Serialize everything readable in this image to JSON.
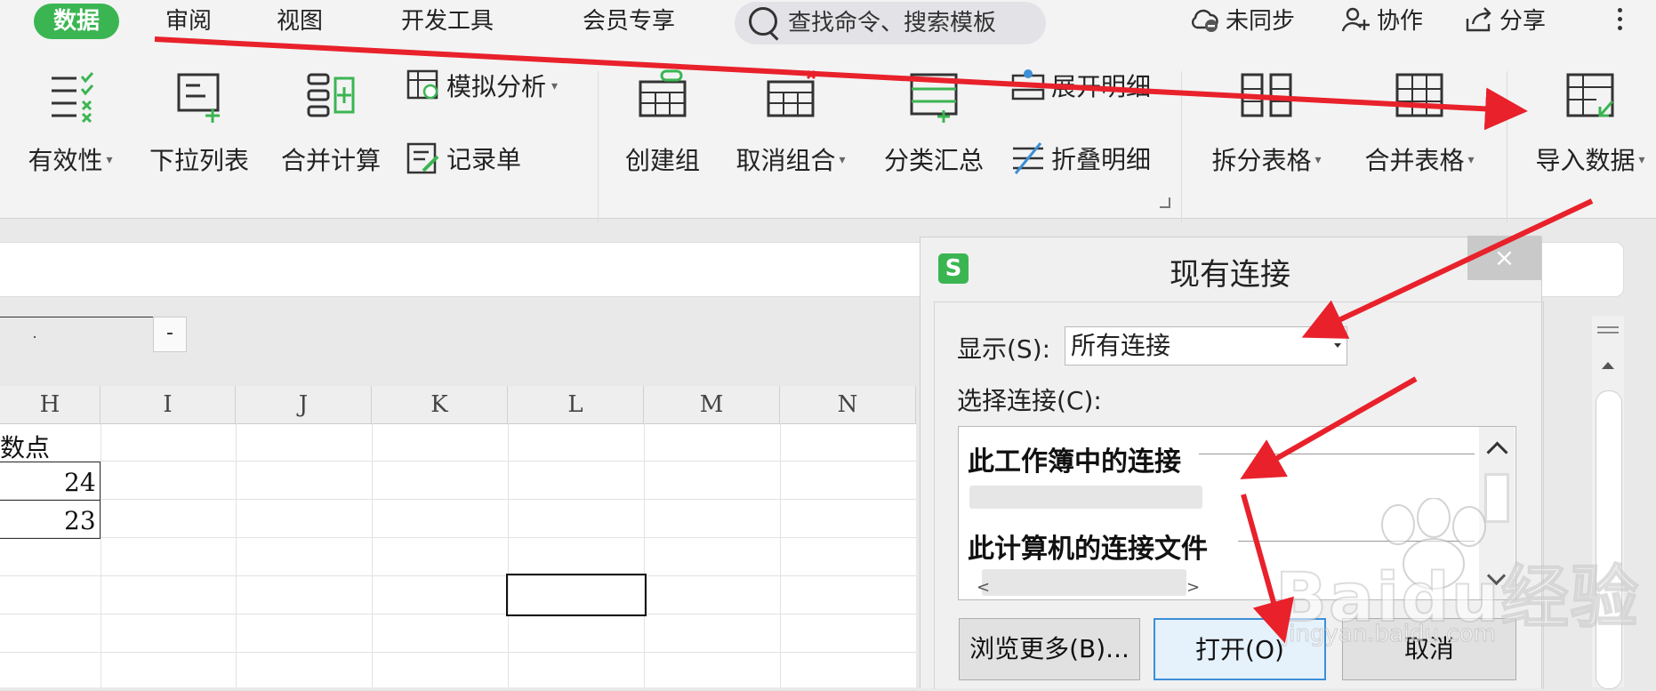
{
  "menu": {
    "tabs": [
      "数据",
      "审阅",
      "视图",
      "开发工具",
      "会员专享"
    ],
    "search_placeholder": "查找命令、搜索模板",
    "sync": "未同步",
    "collab": "协作",
    "share": "分享"
  },
  "ribbon": {
    "validity": "有效性",
    "dropdown_list": "下拉列表",
    "consolidate": "合并计算",
    "what_if": "模拟分析",
    "record_form": "记录单",
    "create_group": "创建组",
    "ungroup": "取消组合",
    "subtotal": "分类汇总",
    "expand_detail": "展开明细",
    "collapse_detail": "折叠明细",
    "split_table": "拆分表格",
    "merge_table": "合并表格",
    "import_data": "导入数据"
  },
  "sheet": {
    "columns": [
      "H",
      "I",
      "J",
      "K",
      "L",
      "M",
      "N"
    ],
    "name_box_button": "-",
    "cells": {
      "h1": "数点",
      "h2": "24",
      "h3": "23"
    }
  },
  "dialog": {
    "title": "现有连接",
    "logo": "S",
    "close": "×",
    "show_label": "显示(S):",
    "show_value": "所有连接",
    "select_label": "选择连接(C):",
    "group_workbook": "此工作簿中的连接",
    "group_computer": "此计算机的连接文件",
    "scroll_left": "<",
    "scroll_right": ">",
    "browse_button": "浏览更多(B)...",
    "open_button": "打开(O)",
    "cancel_button": "取消"
  },
  "watermark": {
    "brand": "Baidu经验",
    "url": "jingyan.baidu.com"
  },
  "colors": {
    "accent_green": "#3bb552",
    "annotation_red": "#e8212b",
    "primary_button_border": "#3c8fd8"
  },
  "icons": {
    "sync": "cloud-off-icon",
    "collab": "add-person-icon",
    "share": "share-icon",
    "more": "more-vertical-icon",
    "search": "search-icon"
  }
}
